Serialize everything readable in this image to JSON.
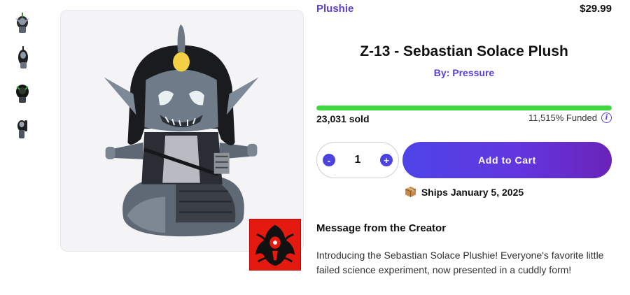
{
  "product": {
    "category": "Plushie",
    "price": "$29.99",
    "title": "Z-13 - Sebastian Solace Plush",
    "creator": "By: Pressure"
  },
  "funding": {
    "progress": 1.0,
    "sold": "23,031 sold",
    "funded": "11,515% Funded",
    "progress_color": "#3fd93f"
  },
  "quantity": {
    "minus": "-",
    "value": "1",
    "plus": "+"
  },
  "cart": {
    "label": "Add to Cart"
  },
  "shipping": {
    "text": "Ships January 5, 2025",
    "icon": "package-icon"
  },
  "message": {
    "heading": "Message from the Creator",
    "body": "Introducing the Sebastian Solace Plushie! Everyone's favorite little failed science experiment, now presented in a cuddly form!"
  },
  "colors": {
    "accent": "#5b3fd8",
    "button_start": "#4e44e6",
    "button_end": "#6a23b8",
    "logo_bg": "#e4190f"
  }
}
